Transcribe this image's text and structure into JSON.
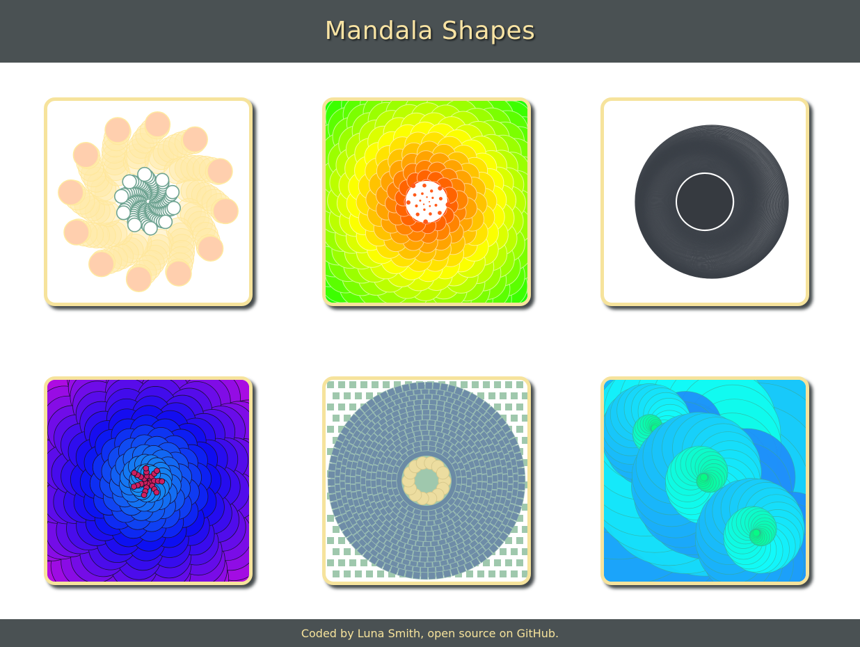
{
  "header": {
    "title": "Mandala Shapes"
  },
  "mandalas": [
    {
      "id": "mandala-1"
    },
    {
      "id": "mandala-2"
    },
    {
      "id": "mandala-3"
    },
    {
      "id": "mandala-4"
    },
    {
      "id": "mandala-5"
    },
    {
      "id": "mandala-6"
    }
  ],
  "colors": {
    "header_bg": "#4a5153",
    "title": "#f8e3a3",
    "card_border": "#f6e39c"
  },
  "footer": {
    "prefix": "Coded by ",
    "author": "Luna Smith",
    "middle": ", open source on ",
    "link": "GitHub",
    "suffix": "."
  }
}
